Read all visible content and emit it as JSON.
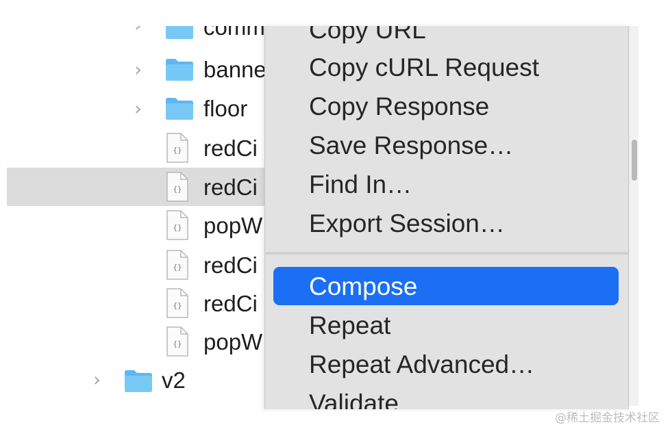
{
  "file_tree": {
    "items": [
      {
        "label": "comm",
        "icon": "folder-icon",
        "expandable": true
      },
      {
        "label": "banne",
        "icon": "folder-icon",
        "expandable": true
      },
      {
        "label": "floor",
        "icon": "folder-icon",
        "expandable": true
      },
      {
        "label": "redCi",
        "icon": "json-file-icon",
        "expandable": false
      },
      {
        "label": "redCi",
        "icon": "json-file-icon",
        "expandable": false,
        "selected": true
      },
      {
        "label": "popW",
        "icon": "json-file-icon",
        "expandable": false
      },
      {
        "label": "redCi",
        "icon": "json-file-icon",
        "expandable": false
      },
      {
        "label": "redCi",
        "icon": "json-file-icon",
        "expandable": false
      },
      {
        "label": "popW",
        "icon": "json-file-icon",
        "expandable": false
      },
      {
        "label": "v2",
        "icon": "folder-icon",
        "expandable": true
      }
    ],
    "file_glyph": "{}"
  },
  "context_menu": {
    "items": [
      {
        "label": "Copy URL"
      },
      {
        "label": "Copy cURL Request"
      },
      {
        "label": "Copy Response"
      },
      {
        "label": "Save Response…"
      },
      {
        "label": "Find In…"
      },
      {
        "label": "Export Session…"
      },
      {
        "label": "Compose",
        "highlighted": true
      },
      {
        "label": "Repeat"
      },
      {
        "label": "Repeat Advanced…"
      },
      {
        "label": "Validate"
      }
    ]
  },
  "watermark": "@稀土掘金技术社区",
  "colors": {
    "menu_background": "#e2e2e2",
    "highlight": "#1a6ff5",
    "selected_row": "#dcdcdc",
    "folder_blue": "#5cb8f0"
  }
}
